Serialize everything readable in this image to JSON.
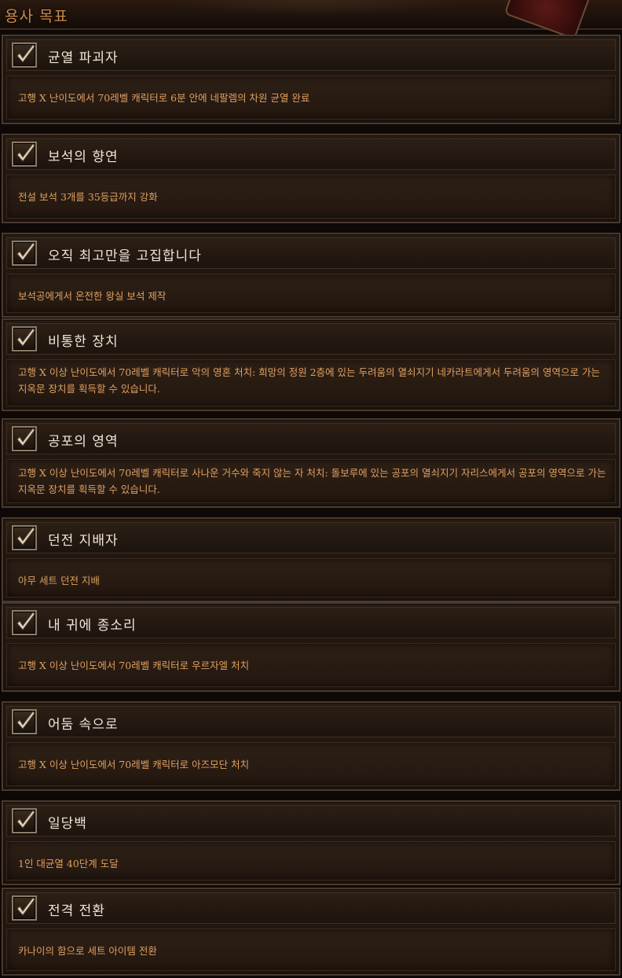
{
  "header": {
    "title": "용사 목표"
  },
  "colors": {
    "title_text": "#f0e6d6",
    "desc_text": "#e0a060",
    "header_text": "#c9894a",
    "checkmark": "#e8d8c0"
  },
  "objectives": [
    {
      "title": "균열 파괴자",
      "desc": "고행 X 난이도에서 70레벨 캐릭터로 6분 안에 네팔렘의 차원 균열 완료",
      "completed": true,
      "icon": "checkmark-icon"
    },
    {
      "title": "보석의 향연",
      "desc": "전설 보석 3개를 35등급까지 강화",
      "completed": true,
      "icon": "checkmark-icon"
    },
    {
      "title": "오직 최고만을 고집합니다",
      "desc": "보석공에게서 온전한 왕실 보석 제작",
      "completed": true,
      "icon": "checkmark-icon"
    },
    {
      "title": "비통한 장치",
      "desc": "고행 X 이상 난이도에서 70레벨 캐릭터로 악의 영혼 처치: 희망의 정원 2층에 있는 두려움의 열쇠지기 네카라트에게서 두려움의 영역으로 가는 지옥문 장치를 획득할 수 있습니다.",
      "completed": true,
      "icon": "checkmark-icon"
    },
    {
      "title": "공포의 영역",
      "desc": "고행 X 이상 난이도에서 70레벨 캐릭터로 사나운 거수와 죽지 않는 자 처치: 돌보루에 있는 공포의 열쇠지기 자리스에게서 공포의 영역으로 가는 지옥문 장치를 획득할 수 있습니다.",
      "completed": true,
      "icon": "checkmark-icon"
    },
    {
      "title": "던전 지배자",
      "desc": "아무 세트 던전 지배",
      "completed": true,
      "icon": "checkmark-icon"
    },
    {
      "title": "내 귀에 종소리",
      "desc": "고행 X 이상 난이도에서 70레벨 캐릭터로 우르자엘 처치",
      "completed": true,
      "icon": "checkmark-icon"
    },
    {
      "title": "어둠 속으로",
      "desc": "고행 X 이상 난이도에서 70레벨 캐릭터로 아즈모단 처치",
      "completed": true,
      "icon": "checkmark-icon"
    },
    {
      "title": "일당백",
      "desc": "1인 대균열 40단계 도달",
      "completed": true,
      "icon": "checkmark-icon"
    },
    {
      "title": "전격 전환",
      "desc": "카나이의 함으로 세트 아이템 전환",
      "completed": true,
      "icon": "checkmark-icon"
    }
  ]
}
